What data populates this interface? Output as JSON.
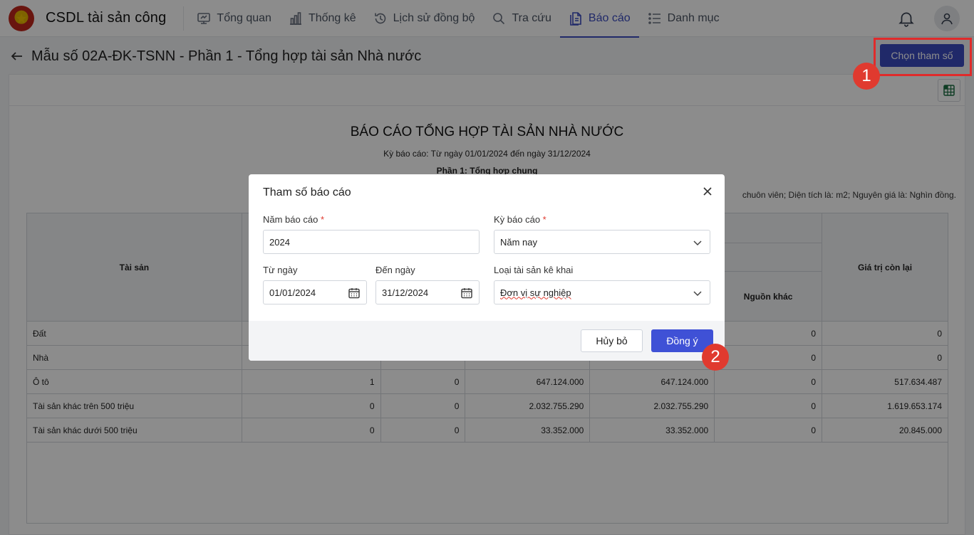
{
  "app": {
    "title": "CSDL tài sản công"
  },
  "nav": [
    {
      "label": "Tổng quan",
      "icon": "dashboard-icon",
      "active": false
    },
    {
      "label": "Thống kê",
      "icon": "bar-chart-icon",
      "active": false
    },
    {
      "label": "Lịch sử đồng bộ",
      "icon": "history-icon",
      "active": false
    },
    {
      "label": "Tra cứu",
      "icon": "search-icon",
      "active": false
    },
    {
      "label": "Báo cáo",
      "icon": "report-icon",
      "active": true
    },
    {
      "label": "Danh mục",
      "icon": "list-icon",
      "active": false
    }
  ],
  "page": {
    "title": "Mẫu số 02A-ĐK-TSNN - Phần 1 - Tổng hợp tài sản Nhà nước",
    "choose_params_label": "Chọn tham số"
  },
  "annotations": {
    "step1": "1",
    "step2": "2"
  },
  "report": {
    "title": "BÁO CÁO TỔNG HỢP TÀI SẢN NHÀ NƯỚC",
    "period": "Kỳ báo cáo: Từ ngày 01/01/2024 đến ngày 31/12/2024",
    "part": "Phần 1: Tổng hợp chung",
    "unit_note": "chuôn viên; Diện tích là: m2; Nguyên giá là: Nghìn đồng.",
    "headers": {
      "asset": "Tài sản",
      "other_source": "Nguồn khác",
      "remaining_value": "Giá trị còn lại"
    },
    "rows": [
      {
        "name": "Đất",
        "c1": "",
        "c2": "",
        "c3": "",
        "c4": "",
        "other": "0",
        "remaining": "0"
      },
      {
        "name": "Nhà",
        "c1": "",
        "c2": "",
        "c3": "",
        "c4": "",
        "other": "0",
        "remaining": "0"
      },
      {
        "name": "Ô tô",
        "c1": "1",
        "c2": "0",
        "c3": "647.124.000",
        "c4": "647.124.000",
        "other": "0",
        "remaining": "517.634.487"
      },
      {
        "name": "Tài sản khác trên 500 triệu",
        "c1": "0",
        "c2": "0",
        "c3": "2.032.755.290",
        "c4": "2.032.755.290",
        "other": "0",
        "remaining": "1.619.653.174"
      },
      {
        "name": "Tài sản khác dưới 500 triệu",
        "c1": "0",
        "c2": "0",
        "c3": "33.352.000",
        "c4": "33.352.000",
        "other": "0",
        "remaining": "20.845.000"
      }
    ]
  },
  "modal": {
    "title": "Tham số báo cáo",
    "year_label": "Năm báo cáo",
    "year_value": "2024",
    "period_label": "Kỳ báo cáo",
    "period_value": "Năm nay",
    "from_label": "Từ ngày",
    "from_value": "01/01/2024",
    "to_label": "Đến ngày",
    "to_value": "31/12/2024",
    "asset_type_label": "Loại tài sản kê khai",
    "asset_type_value": "Đơn vị sự nghiệp",
    "required_mark": "*",
    "cancel_label": "Hủy bỏ",
    "ok_label": "Đồng ý"
  },
  "colors": {
    "primary": "#3b4cc0",
    "annotation_red": "#e03a2f"
  }
}
